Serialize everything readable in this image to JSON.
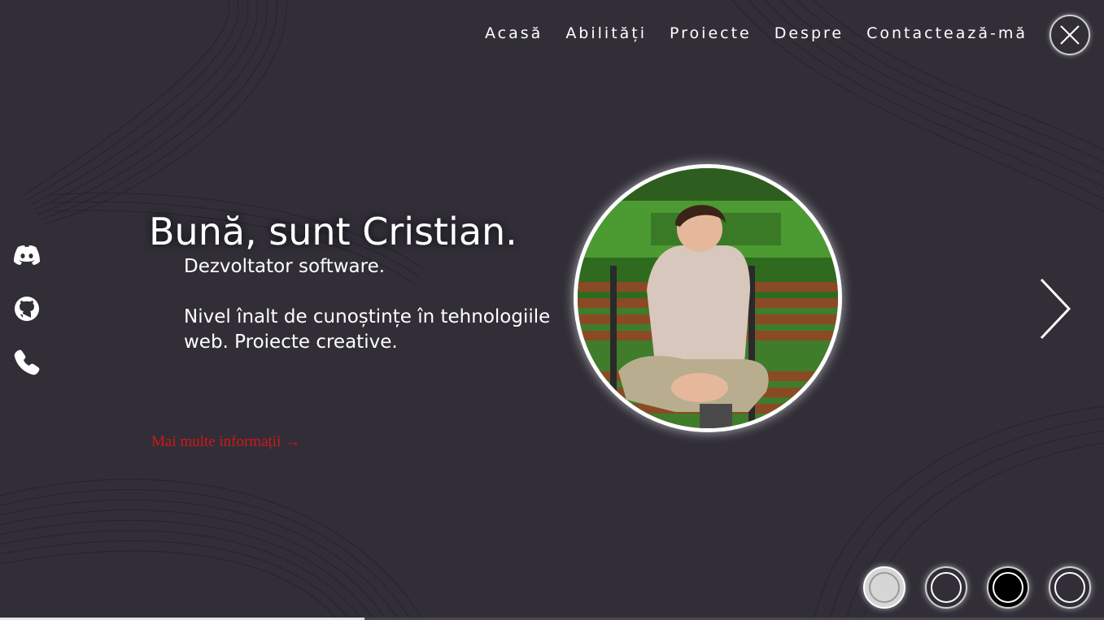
{
  "nav": {
    "items": [
      "Acasă",
      "Abilități",
      "Proiecte",
      "Despre",
      "Contactează-mă"
    ]
  },
  "hero": {
    "headline": "Bună, sunt Cristian.",
    "role": "Dezvoltator software.",
    "description": "Nivel înalt de cunoștințe în tehnologiile web. Proiecte creative.",
    "more_link": "Mai multe informații →"
  },
  "socials": [
    {
      "icon": "discord-icon"
    },
    {
      "icon": "github-icon"
    },
    {
      "icon": "phone-icon"
    }
  ],
  "slider": {
    "dots": 4,
    "active_index": 2
  },
  "colors": {
    "background": "#312e38",
    "text": "#ffffff",
    "link": "#d31616"
  }
}
